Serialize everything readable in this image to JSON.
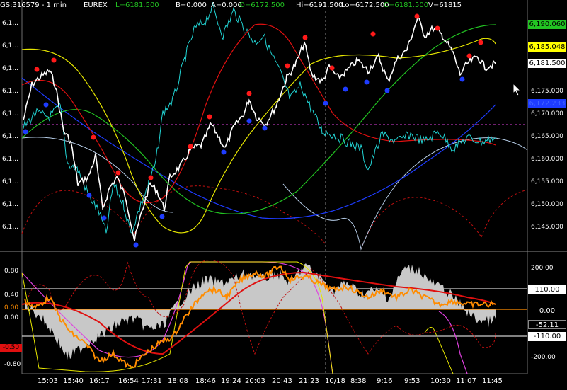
{
  "header": {
    "symbol": "GS:316579 - 1 min",
    "exchange": "EUREX",
    "last": "L=6181.500",
    "bid": "B=0.000",
    "ask": "A=0.000",
    "open": "O=6172.500",
    "high": "Hi=6191.500",
    "low": "Lo=6172.500",
    "close": "C=6181.500",
    "volume": "V=61815"
  },
  "price_axis": {
    "ticks": [
      "6,175.000",
      "6,170.000",
      "6,165.000",
      "6,160.000",
      "6,155.000",
      "6,150.000",
      "6,145.000"
    ],
    "left_ticks": [
      "6,1...",
      "6,1...",
      "6,1...",
      "6,1...",
      "6,1...",
      "6,1...",
      "6,1...",
      "6,1...",
      "6,1...",
      "6,1..."
    ],
    "tags": [
      {
        "text": "6,190.060",
        "bg": "#22c322",
        "fg": "#000000"
      },
      {
        "text": "6,185.048",
        "bg": "#ffff00",
        "fg": "#000000"
      },
      {
        "text": "6,181.500",
        "bg": "#ffffff",
        "fg": "#000000"
      },
      {
        "text": "6,172.233",
        "bg": "#1e3cff",
        "fg": "#4466ff"
      }
    ]
  },
  "osc_axis": {
    "left_ticks": [
      "0.80",
      "0.40",
      "0.00",
      "-0.50",
      "-0.80"
    ],
    "left_tags": [
      {
        "text": "0.00"
      },
      {
        "text": "-0.50"
      }
    ],
    "right_ticks": [
      "200.00",
      "-200.00"
    ],
    "right_tags": [
      {
        "text": "110.00",
        "bg": "#ffffff",
        "fg": "#000000"
      },
      {
        "text": "0.00",
        "bg": "#000000",
        "fg": "#ffffff"
      },
      {
        "text": "-52.11",
        "bg": "#000000",
        "fg": "#ffffff"
      },
      {
        "text": "-110.00",
        "bg": "#ffffff",
        "fg": "#000000"
      }
    ]
  },
  "time_axis": [
    "15:03",
    "15:40",
    "16:17",
    "16:54",
    "17:31",
    "18:08",
    "18:46",
    "19:24",
    "20:03",
    "20:43",
    "21:23",
    "10/18",
    "8:38",
    "9:16",
    "9:53",
    "10:30",
    "11:07",
    "11:45"
  ],
  "colors": {
    "price": "#ffffff",
    "cyan": "#22d4d4",
    "red": "#e01010",
    "yellow": "#e6e600",
    "green": "#22c322",
    "blue": "#1e3cff",
    "lightblue": "#b6cde8",
    "magenta": "#e040e0",
    "orange": "#ff8c00",
    "gray": "#c8c8c8"
  }
}
